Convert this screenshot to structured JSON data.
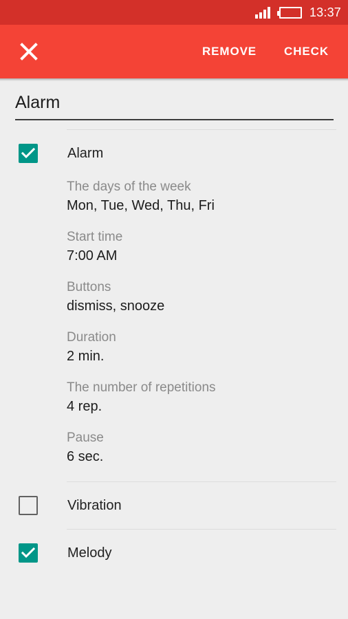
{
  "status_bar": {
    "time": "13:37",
    "signal_icon": "signal-bars-icon",
    "battery_icon": "battery-icon",
    "background_color": "#d33029"
  },
  "app_bar": {
    "background_color": "#f44336",
    "close_icon": "close-x-icon",
    "remove_label": "REMOVE",
    "check_label": "CHECK"
  },
  "title": {
    "value": "Alarm"
  },
  "alarm_section": {
    "checkbox_label": "Alarm",
    "checked": true,
    "accent_color": "#009688",
    "details": [
      {
        "label": "The days of the week",
        "value": "Mon, Tue, Wed, Thu, Fri"
      },
      {
        "label": "Start time",
        "value": "7:00 AM"
      },
      {
        "label": "Buttons",
        "value": "dismiss, snooze"
      },
      {
        "label": "Duration",
        "value": "2 min."
      },
      {
        "label": "The number of repetitions",
        "value": "4 rep."
      },
      {
        "label": "Pause",
        "value": "6 sec."
      }
    ]
  },
  "vibration_section": {
    "checkbox_label": "Vibration",
    "checked": false
  },
  "melody_section": {
    "checkbox_label": "Melody",
    "checked": true
  }
}
